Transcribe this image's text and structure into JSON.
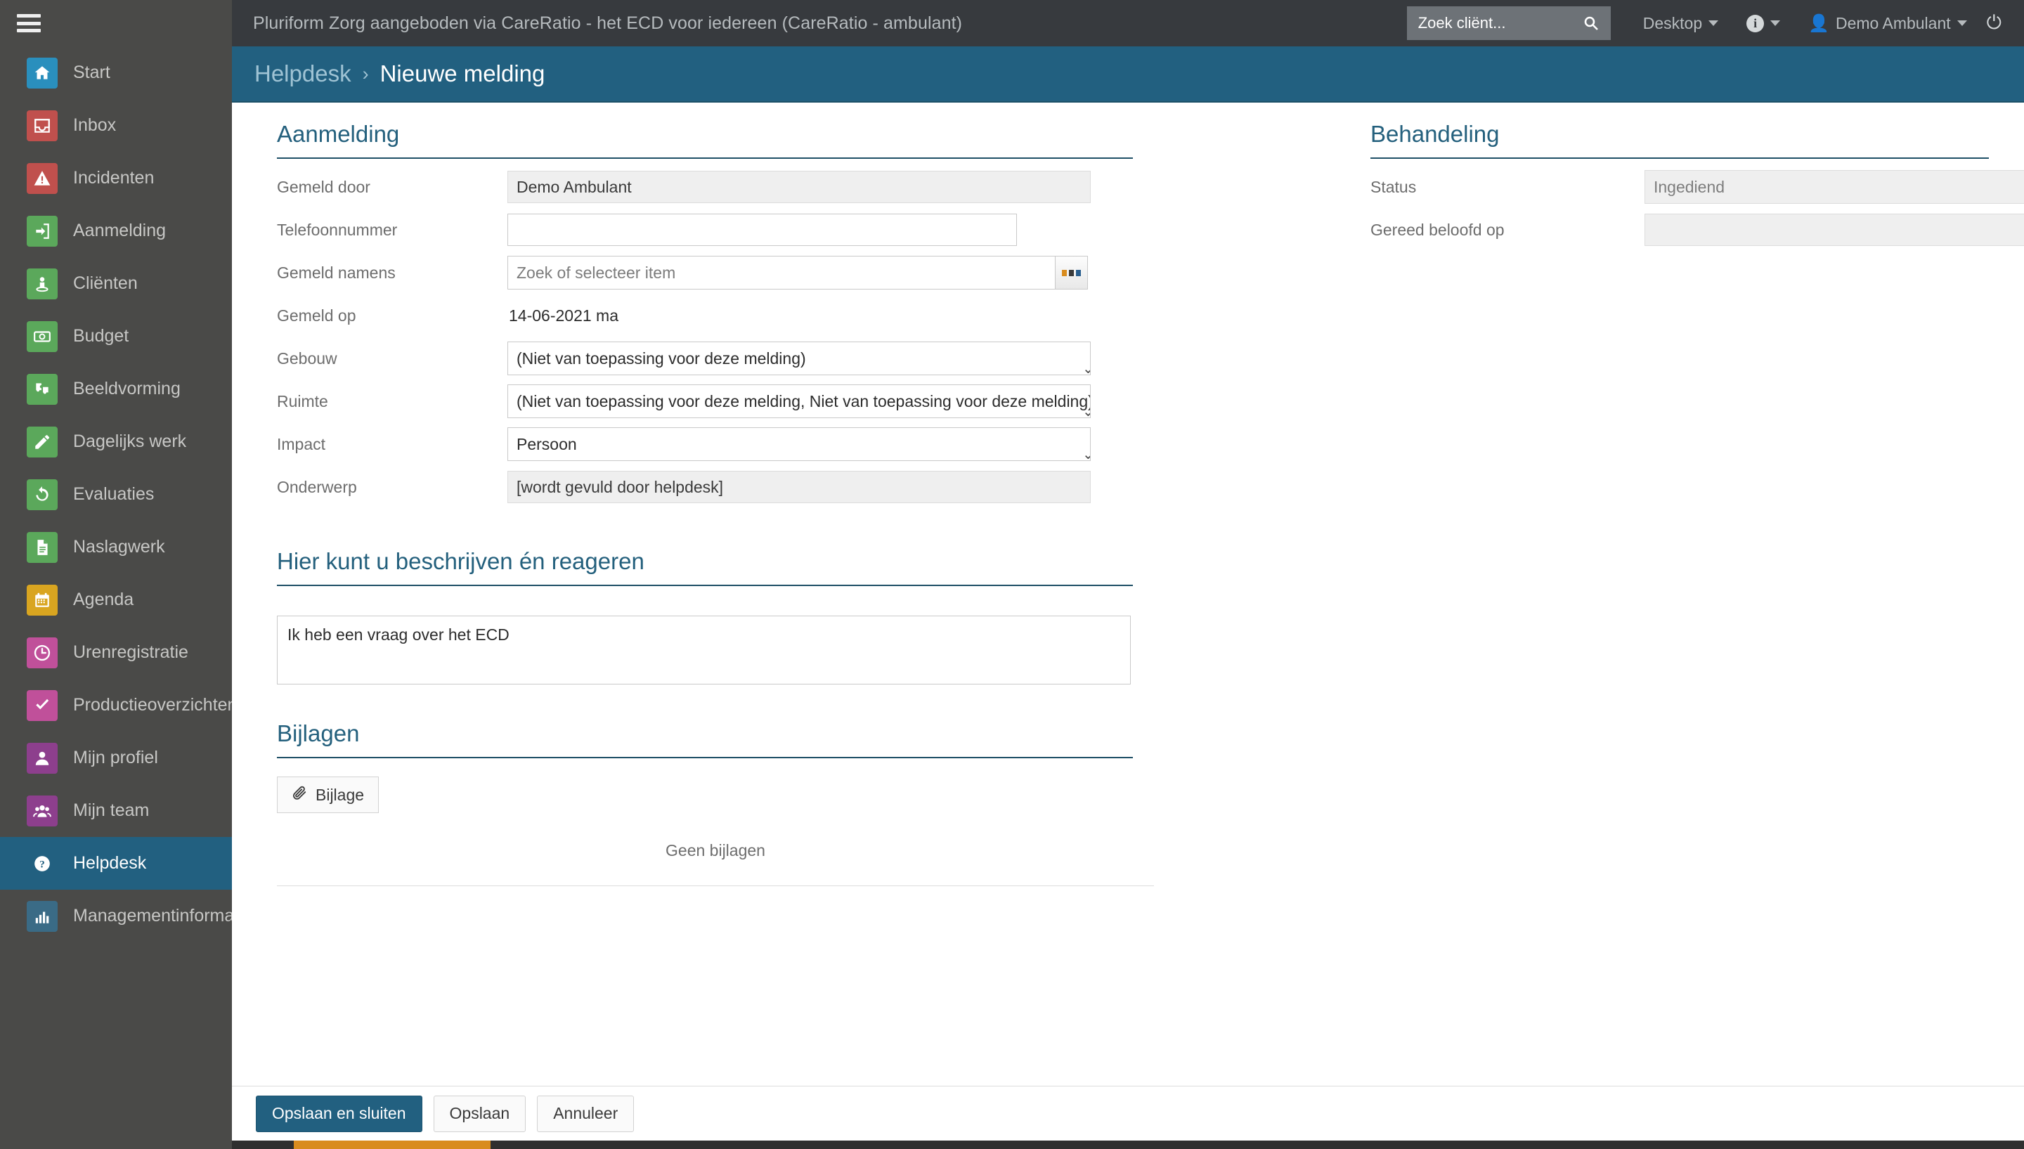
{
  "topbar": {
    "menu_icon": "hamburger-icon",
    "app_title": "Pluriform Zorg aangeboden via CareRatio - het ECD voor iedereen  (CareRatio - ambulant)",
    "search_placeholder": "Zoek cliënt...",
    "search_value": "",
    "search_icon": "search-icon",
    "desktop_label": "Desktop",
    "info_icon": "info-icon",
    "user_label": "Demo Ambulant",
    "user_icon": "user-icon",
    "power_icon": "power-icon"
  },
  "sidebar": {
    "items": [
      {
        "label": "Start",
        "icon": "home-icon",
        "color": "#2a8fbd",
        "active": false
      },
      {
        "label": "Inbox",
        "icon": "inbox-icon",
        "color": "#c0504d",
        "active": false
      },
      {
        "label": "Incidenten",
        "icon": "warning-icon",
        "color": "#c0504d",
        "active": false
      },
      {
        "label": "Aanmelding",
        "icon": "signin-icon",
        "color": "#5ba85b",
        "active": false
      },
      {
        "label": "Cliënten",
        "icon": "person-icon",
        "color": "#5ba85b",
        "active": false
      },
      {
        "label": "Budget",
        "icon": "money-icon",
        "color": "#5ba85b",
        "active": false
      },
      {
        "label": "Beeldvorming",
        "icon": "puzzle-icon",
        "color": "#5ba85b",
        "active": false
      },
      {
        "label": "Dagelijks werk",
        "icon": "pencil-icon",
        "color": "#5ba85b",
        "active": false
      },
      {
        "label": "Evaluaties",
        "icon": "refresh-icon",
        "color": "#5ba85b",
        "active": false
      },
      {
        "label": "Naslagwerk",
        "icon": "document-icon",
        "color": "#5ba85b",
        "active": false
      },
      {
        "label": "Agenda",
        "icon": "calendar-icon",
        "color": "#d9a520",
        "active": false
      },
      {
        "label": "Urenregistratie",
        "icon": "clock-icon",
        "color": "#c0509a",
        "active": false
      },
      {
        "label": "Productieoverzichten",
        "icon": "check-icon",
        "color": "#c0509a",
        "active": false
      },
      {
        "label": "Mijn profiel",
        "icon": "avatar-icon",
        "color": "#8d3f8d",
        "active": false
      },
      {
        "label": "Mijn team",
        "icon": "group-icon",
        "color": "#8d3f8d",
        "active": false
      },
      {
        "label": "Helpdesk",
        "icon": "question-icon",
        "color": "transparent",
        "active": true
      },
      {
        "label": "Managementinformatie",
        "icon": "barchart-icon",
        "color": "#3a6b86",
        "active": false
      }
    ]
  },
  "breadcrumb": {
    "parent": "Helpdesk",
    "separator": "›",
    "current": "Nieuwe melding"
  },
  "aanmelding": {
    "title": "Aanmelding",
    "fields": {
      "gemeld_door_label": "Gemeld door",
      "gemeld_door_value": "Demo Ambulant",
      "telefoonnummer_label": "Telefoonnummer",
      "telefoonnummer_value": "",
      "gemeld_namens_label": "Gemeld namens",
      "gemeld_namens_placeholder": "Zoek of selecteer item",
      "gemeld_namens_button_icon": "ellipsis-icon",
      "gemeld_op_label": "Gemeld op",
      "gemeld_op_value": "14-06-2021 ma",
      "gebouw_label": "Gebouw",
      "gebouw_value": "(Niet van toepassing voor deze melding)",
      "ruimte_label": "Ruimte",
      "ruimte_value": "(Niet van toepassing voor deze melding, Niet van toepassing voor deze melding)",
      "impact_label": "Impact",
      "impact_value": "Persoon",
      "onderwerp_label": "Onderwerp",
      "onderwerp_value": "[wordt gevuld door helpdesk]"
    }
  },
  "behandeling": {
    "title": "Behandeling",
    "fields": {
      "status_label": "Status",
      "status_value": "Ingediend",
      "gereed_beloofd_label": "Gereed beloofd op",
      "gereed_beloofd_value": ""
    }
  },
  "beschrijving": {
    "title": "Hier kunt u beschrijven én reageren",
    "text": "Ik heb een vraag over het ECD"
  },
  "bijlagen": {
    "title": "Bijlagen",
    "add_button_label": "Bijlage",
    "add_button_icon": "paperclip-icon",
    "empty_text": "Geen bijlagen"
  },
  "footer": {
    "save_close_label": "Opslaan en sluiten",
    "save_label": "Opslaan",
    "cancel_label": "Annuleer"
  },
  "colors": {
    "accent": "#226080",
    "sidebar_bg": "#4a4a48",
    "topbar_bg": "#373a3e",
    "section_title": "#24607d",
    "orange": "#d98c1e"
  }
}
